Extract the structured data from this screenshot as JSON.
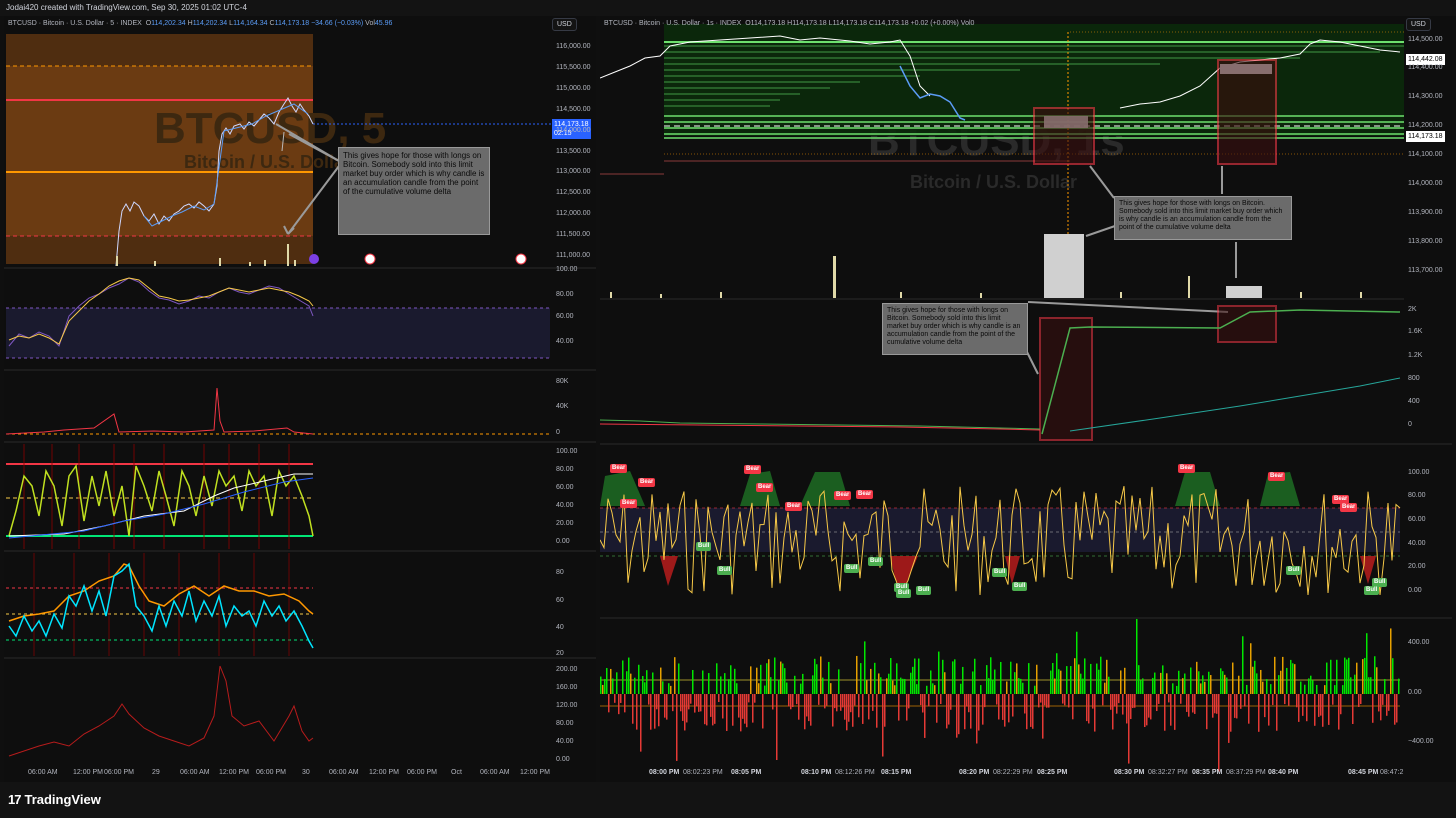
{
  "top_bar": {
    "text": "Jodai420 created with TradingView.com, Sep 30, 2025 01:02 UTC-4"
  },
  "left_chart": {
    "symbol": "BTCUSD · Bitcoin · U.S. Dollar · 5 · INDEX",
    "o_label": "O",
    "o": "114,202.34",
    "h_label": "H",
    "h": "114,202.34",
    "l_label": "L",
    "l": "114,164.34",
    "c_label": "C",
    "c": "114,173.18",
    "change": "−34.66 (−0.03%)",
    "vol_label": "Vol",
    "vol": "45.96",
    "currency": "USD",
    "watermark_main": "BTCUSD, 5",
    "watermark_sub": "Bitcoin / U.S. Dollar",
    "last_price": "114,173.18",
    "countdown": "02:15",
    "price_ticks": [
      "116,000.00",
      "115,500.00",
      "115,000.00",
      "114,500.00",
      "114,000.00",
      "113,500.00",
      "113,000.00",
      "112,500.00",
      "112,000.00",
      "111,500.00",
      "111,000.00"
    ],
    "note": "This gives hope for those with longs on Bitcoin. Somebody sold into this limit market buy order which is why candle is an accumulation candle from the point of the cumulative volume delta",
    "pane2_ticks": [
      "100.00",
      "80.00",
      "60.00",
      "40.00"
    ],
    "pane3_ticks": [
      "80K",
      "40K",
      "0"
    ],
    "pane4_ticks": [
      "100.00",
      "80.00",
      "60.00",
      "40.00",
      "20.00",
      "0.00"
    ],
    "pane5_ticks": [
      "80",
      "60",
      "40",
      "20"
    ],
    "pane6_ticks": [
      "200.00",
      "160.00",
      "120.00",
      "80.00",
      "40.00",
      "0.00"
    ],
    "time_ticks": [
      "06:00 AM",
      "12:00 PM",
      "06:00 PM",
      "29",
      "06:00 AM",
      "12:00 PM",
      "06:00 PM",
      "30",
      "06:00 AM",
      "12:00 PM",
      "06:00 PM",
      "Oct",
      "06:00 AM",
      "12:00 PM"
    ]
  },
  "right_chart": {
    "symbol": "BTCUSD · Bitcoin · U.S. Dollar · 1s · INDEX",
    "o_label": "O",
    "o": "114,173.18",
    "h_label": "H",
    "h": "114,173.18",
    "l_label": "L",
    "l": "114,173.18",
    "c_label": "C",
    "c": "114,173.18",
    "change": "+0.02 (+0.00%)",
    "vol_label": "Vol",
    "vol": "0",
    "currency": "USD",
    "watermark_main": "BTCUSD, 1s",
    "watermark_sub": "Bitcoin / U.S. Dollar",
    "last_price": "114,173.18",
    "other_price": "114,442.08",
    "price_ticks": [
      "114,500.00",
      "114,400.00",
      "114,300.00",
      "114,200.00",
      "114,100.00",
      "114,000.00",
      "113,900.00",
      "113,800.00",
      "113,700.00"
    ],
    "note_top": "This gives hope for those with longs on Bitcoin. Somebody sold into this limit market buy order which is why candle is an accumulation candle from the point of the cumulative volume delta",
    "note_mid": "This gives hope for those with longs on Bitcoin. Somebody sold into this limit market buy order which is why candle is an accumulation candle from the point of the cumulative volume delta",
    "pane2_ticks": [
      "2K",
      "1.6K",
      "1.2K",
      "800",
      "400",
      "0"
    ],
    "pane3_ticks": [
      "100.00",
      "80.00",
      "60.00",
      "40.00",
      "20.00",
      "0.00"
    ],
    "pane4_ticks": [
      "400.00",
      "0.00",
      "−400.00"
    ],
    "bear_label": "Bear",
    "bull_label": "Bull",
    "time_ticks": [
      "08:00 PM",
      "08:02:23 PM",
      "08:05 PM",
      "08:10 PM",
      "08:12:26 PM",
      "08:15 PM",
      "08:20 PM",
      "08:22:29 PM",
      "08:25 PM",
      "08:30 PM",
      "08:32:27 PM",
      "08:35 PM",
      "08:37:29 PM",
      "08:40 PM",
      "08:45 PM",
      "08:47:2"
    ]
  },
  "footer": {
    "brand": "TradingView",
    "brand_mark": "17"
  },
  "colors": {
    "bg": "#0f0f0f",
    "green": "#4caf50",
    "red": "#f23645",
    "blue": "#2962ff",
    "orange": "#ff9800"
  }
}
